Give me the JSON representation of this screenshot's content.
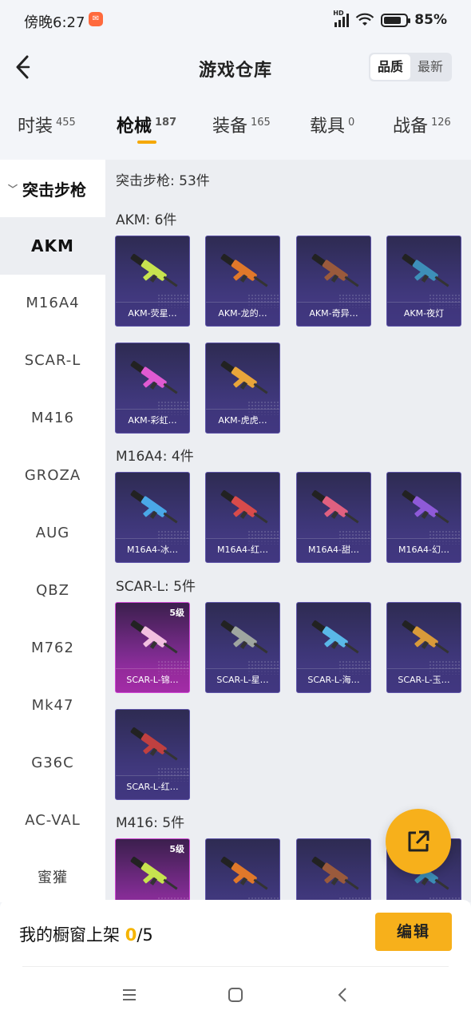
{
  "status_bar": {
    "time": "傍晚6:27",
    "network": "HD",
    "battery": "85%"
  },
  "header": {
    "title": "游戏仓库",
    "sort_options": [
      "品质",
      "最新"
    ],
    "sort_selected": "品质"
  },
  "category_tabs": [
    {
      "label": "时装",
      "count": "455"
    },
    {
      "label": "枪械",
      "count": "187",
      "active": true
    },
    {
      "label": "装备",
      "count": "165"
    },
    {
      "label": "载具",
      "count": "0"
    },
    {
      "label": "战备",
      "count": "126"
    }
  ],
  "sidebar": {
    "group": "突击步枪",
    "items": [
      "AKM",
      "M16A4",
      "SCAR-L",
      "M416",
      "GROZA",
      "AUG",
      "QBZ",
      "M762",
      "Mk47",
      "G36C",
      "AC-VAL",
      "蜜獾"
    ],
    "selected": "AKM"
  },
  "main": {
    "summary": "突击步枪: 53件",
    "sections": [
      {
        "title": "AKM: 6件",
        "items": [
          {
            "name": "AKM-荧星…"
          },
          {
            "name": "AKM-龙的…"
          },
          {
            "name": "AKM-奇异…"
          },
          {
            "name": "AKM-夜灯"
          },
          {
            "name": "AKM-彩虹…"
          },
          {
            "name": "AKM-虎虎…"
          }
        ]
      },
      {
        "title": "M16A4: 4件",
        "items": [
          {
            "name": "M16A4-冰…"
          },
          {
            "name": "M16A4-红…"
          },
          {
            "name": "M16A4-甜…"
          },
          {
            "name": "M16A4-幻…"
          }
        ]
      },
      {
        "title": "SCAR-L: 5件",
        "items": [
          {
            "name": "SCAR-L-锦…",
            "level": "5级"
          },
          {
            "name": "SCAR-L-星…"
          },
          {
            "name": "SCAR-L-海…"
          },
          {
            "name": "SCAR-L-玉…"
          },
          {
            "name": "SCAR-L-红…"
          }
        ]
      },
      {
        "title": "M416: 5件",
        "items": [
          {
            "name": "",
            "level": "5级"
          },
          {
            "name": ""
          },
          {
            "name": ""
          },
          {
            "name": ""
          }
        ]
      }
    ]
  },
  "bottom_bar": {
    "showcase_label": "我的橱窗上架",
    "showcase_count": "0",
    "showcase_total": "/5",
    "edit_label": "编辑"
  },
  "colors": {
    "accent": "#f7b01b",
    "card_normal": "#3d3677",
    "card_legendary": "#b030b8"
  }
}
